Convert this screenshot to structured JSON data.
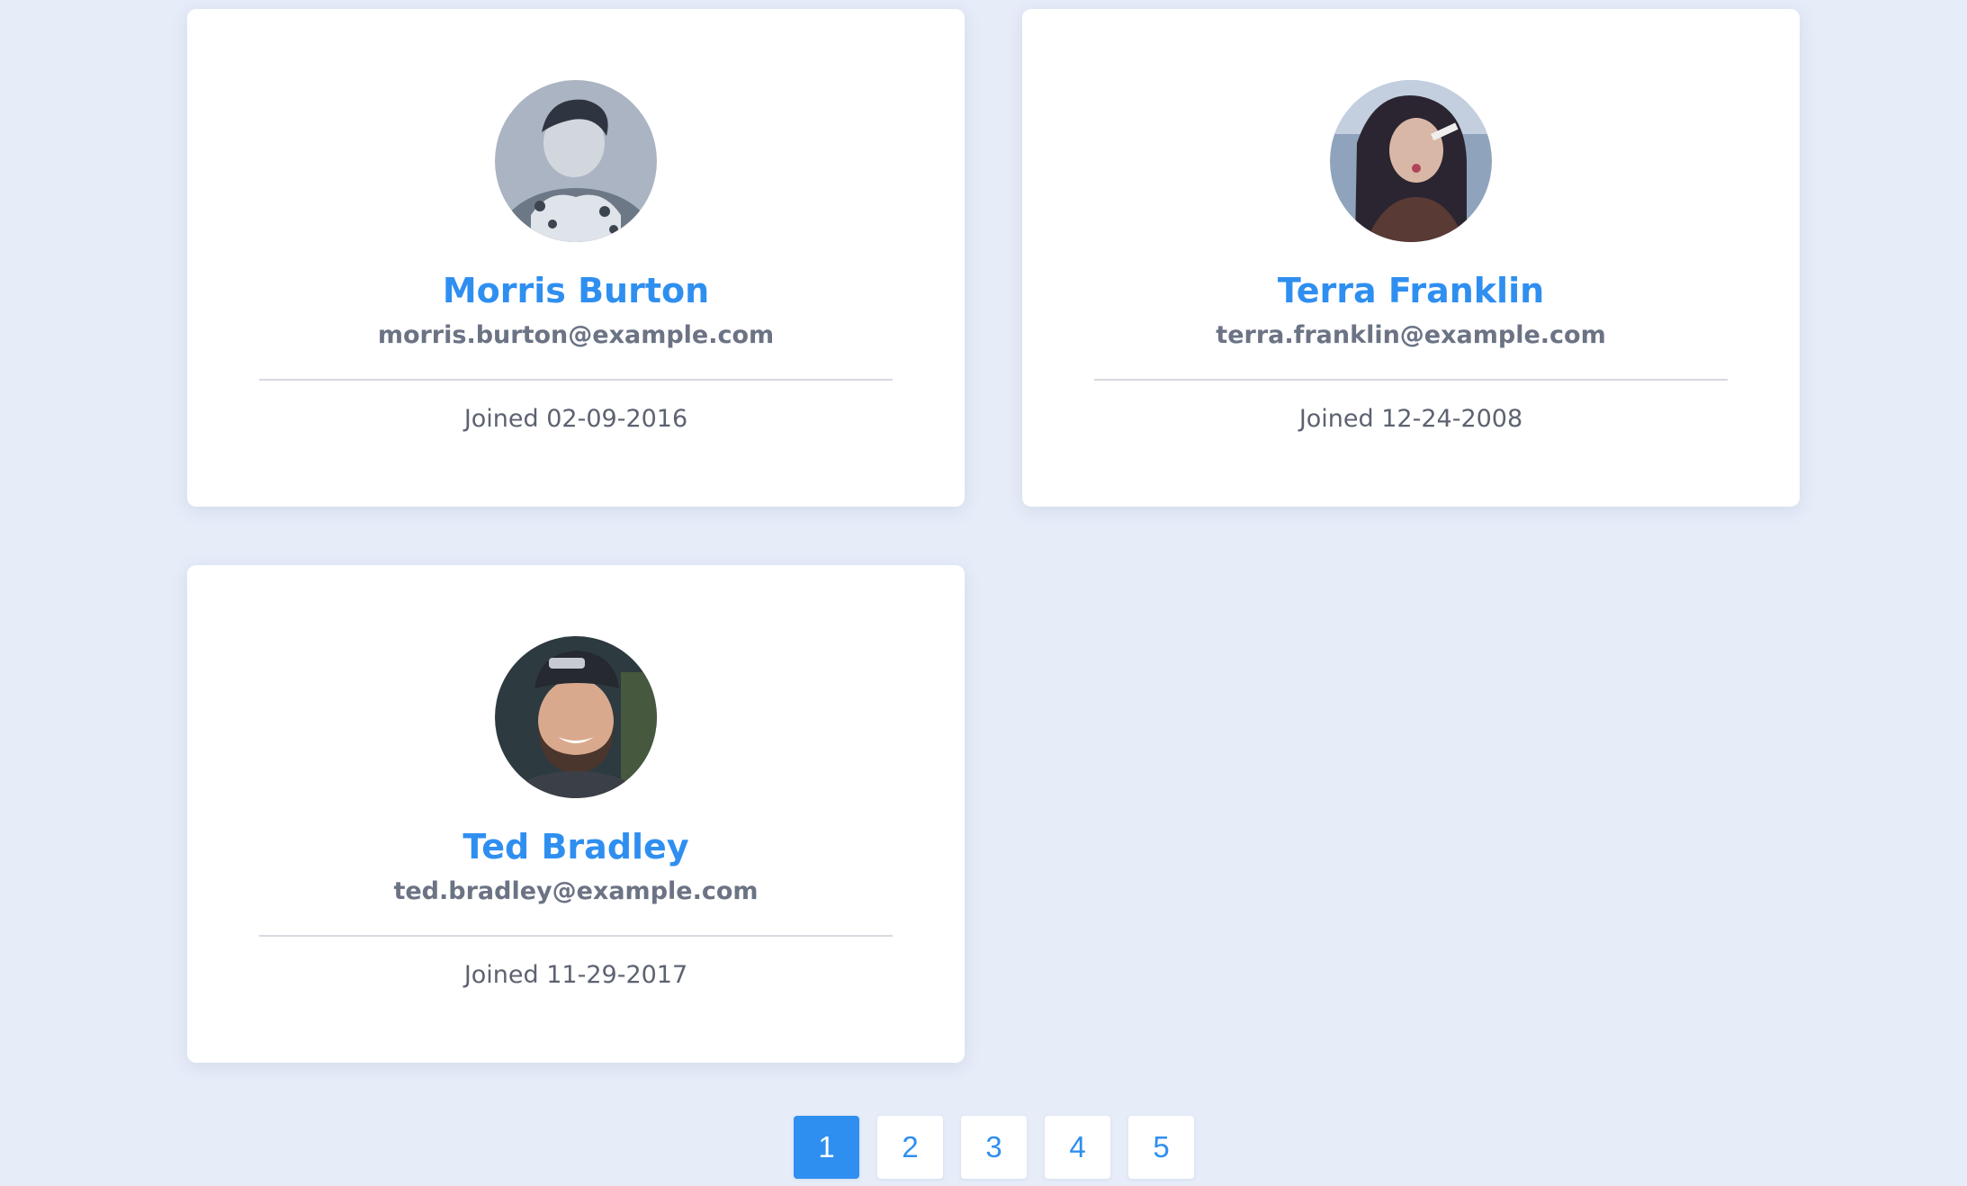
{
  "theme": {
    "background": "#e6ecf8",
    "name_color": "#2f8ff0",
    "email_color": "#6b7384",
    "joined_color": "#5c6270",
    "active_page_bg": "#2f8ff0",
    "page_text_color": "#2f8ff0"
  },
  "users": [
    {
      "avatar_icon": "user-avatar-photo",
      "name": "Morris Burton",
      "email": "morris.burton@example.com",
      "joined": "Joined 02-09-2016"
    },
    {
      "avatar_icon": "user-avatar-photo",
      "name": "Terra Franklin",
      "email": "terra.franklin@example.com",
      "joined": "Joined 12-24-2008"
    },
    {
      "avatar_icon": "user-avatar-photo",
      "name": "Ted Bradley",
      "email": "ted.bradley@example.com",
      "joined": "Joined 11-29-2017"
    }
  ],
  "pagination": {
    "pages": [
      "1",
      "2",
      "3",
      "4",
      "5"
    ],
    "current": "1"
  }
}
